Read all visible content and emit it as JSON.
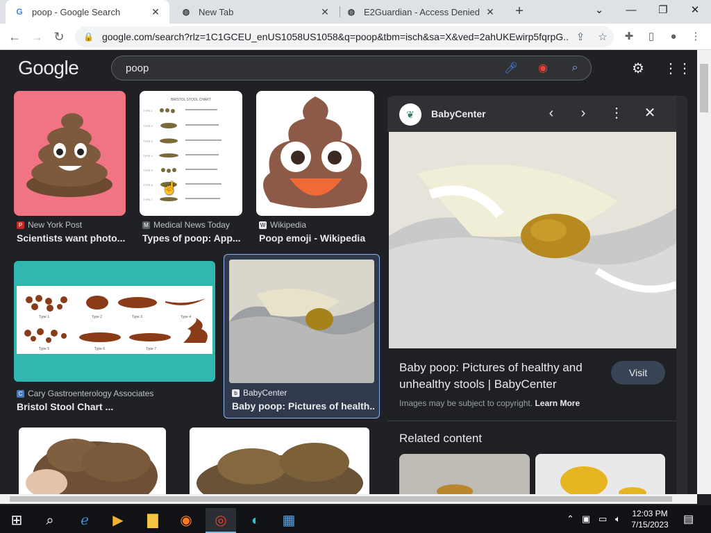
{
  "browser": {
    "tabs": [
      {
        "title": "poop - Google Search",
        "active": true
      },
      {
        "title": "New Tab",
        "active": false
      },
      {
        "title": "E2Guardian - Access Denied",
        "active": false
      }
    ],
    "url": "google.com/search?rlz=1C1GCEU_enUS1058US1058&q=poop&tbm=isch&sa=X&ved=2ahUKEwirp5fqrpG..."
  },
  "google": {
    "logo": "Google",
    "query": "poop"
  },
  "results": [
    {
      "source": "New York Post",
      "title": "Scientists want photo..."
    },
    {
      "source": "Medical News Today",
      "title": "Types of poop: App..."
    },
    {
      "source": "Wikipedia",
      "title": "Poop emoji - Wikipedia"
    },
    {
      "source": "Cary Gastroenterology Associates",
      "title": "Bristol Stool Chart ..."
    },
    {
      "source": "BabyCenter",
      "title": "Baby poop: Pictures of health..."
    }
  ],
  "bristol_chart": {
    "heading": "BRISTOL STOOL CHART",
    "rows": [
      "TYPE 1",
      "TYPE 2",
      "TYPE 3",
      "TYPE 4",
      "TYPE 5",
      "TYPE 6",
      "TYPE 7"
    ],
    "wide_labels": [
      "Type 1",
      "Type 2",
      "Type 3",
      "Type 4",
      "Type 5",
      "Type 6",
      "Type 7"
    ]
  },
  "panel": {
    "site": "BabyCenter",
    "title": "Baby poop: Pictures of healthy and unhealthy stools | BabyCenter",
    "visit_label": "Visit",
    "copyright": "Images may be subject to copyright.",
    "learn_more": "Learn More",
    "related_heading": "Related content"
  },
  "taskbar": {
    "time": "12:03 PM",
    "date": "7/15/2023"
  },
  "colors": {
    "page_bg": "#202124",
    "accent": "#8ab4f8",
    "panel_bg": "#1f2023"
  }
}
